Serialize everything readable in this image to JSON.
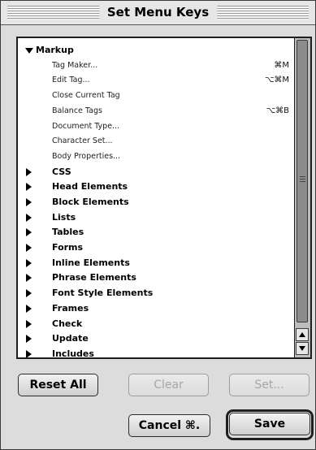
{
  "window": {
    "title": "Set Menu Keys"
  },
  "list": {
    "groups": [
      {
        "label": "Markup",
        "expanded": true,
        "items": [
          {
            "label": "Tag Maker...",
            "shortcut": "⌘M"
          },
          {
            "label": "Edit Tag...",
            "shortcut": "⌥⌘M"
          },
          {
            "label": "Close Current Tag",
            "shortcut": ""
          },
          {
            "label": "Balance Tags",
            "shortcut": "⌥⌘B"
          },
          {
            "label": "Document Type...",
            "shortcut": ""
          },
          {
            "label": "Character Set...",
            "shortcut": ""
          },
          {
            "label": "Body Properties...",
            "shortcut": ""
          }
        ]
      },
      {
        "label": "CSS",
        "expanded": false
      },
      {
        "label": "Head Elements",
        "expanded": false
      },
      {
        "label": "Block Elements",
        "expanded": false
      },
      {
        "label": "Lists",
        "expanded": false
      },
      {
        "label": "Tables",
        "expanded": false
      },
      {
        "label": "Forms",
        "expanded": false
      },
      {
        "label": "Inline Elements",
        "expanded": false
      },
      {
        "label": "Phrase Elements",
        "expanded": false
      },
      {
        "label": "Font Style Elements",
        "expanded": false
      },
      {
        "label": "Frames",
        "expanded": false
      },
      {
        "label": "Check",
        "expanded": false
      },
      {
        "label": "Update",
        "expanded": false
      },
      {
        "label": "Includes",
        "expanded": false
      }
    ]
  },
  "buttons": {
    "reset_all": "Reset All",
    "clear": "Clear",
    "set": "Set...",
    "cancel": "Cancel ⌘.",
    "save": "Save"
  }
}
